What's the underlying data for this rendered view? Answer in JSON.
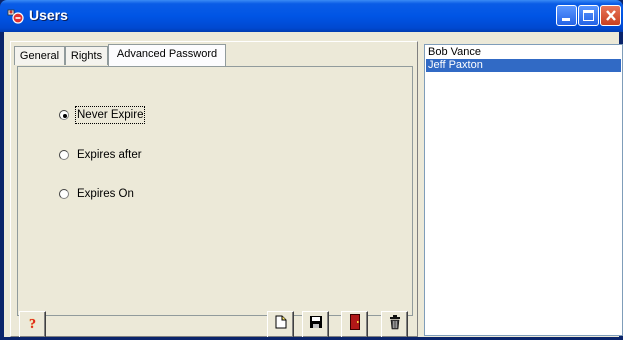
{
  "window": {
    "title": "Users",
    "controls": [
      "minimize-icon",
      "maximize-icon",
      "close-icon"
    ]
  },
  "tabs": [
    {
      "label": "General",
      "active": false
    },
    {
      "label": "Rights",
      "active": false
    },
    {
      "label": "Advanced Password",
      "active": true
    }
  ],
  "password_expiry": {
    "options": [
      {
        "label": "Never Expire",
        "selected": true
      },
      {
        "label": "Expires after",
        "selected": false
      },
      {
        "label": "Expires On",
        "selected": false
      }
    ]
  },
  "toolbar": {
    "help_icon": "question-mark-icon",
    "new_icon": "new-document-icon",
    "save_icon": "floppy-disk-icon",
    "exit_icon": "door-exit-icon",
    "delete_icon": "trash-can-icon"
  },
  "users": {
    "items": [
      {
        "name": "Bob Vance",
        "selected": false
      },
      {
        "name": "Jeff Paxton",
        "selected": true
      }
    ]
  },
  "colors": {
    "titlebar": "#0055e5",
    "selection": "#316ac5",
    "face": "#ece9d8"
  }
}
